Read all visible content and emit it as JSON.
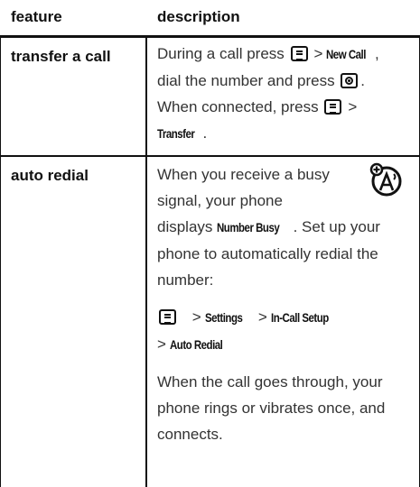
{
  "table": {
    "headers": {
      "feature": "feature",
      "description": "description"
    },
    "rows": [
      {
        "feature": "transfer a call",
        "description": {
          "part1": "During a call press",
          "menu1": "New Call",
          "part2": "dial the number and press",
          "part3": "When connected, press",
          "menu2": "Transfer",
          "gt": ">",
          "comma": ",",
          "period": "."
        }
      },
      {
        "feature": "auto redial",
        "icon": "auto-redial-icon",
        "description": {
          "line1": "When you receive a busy",
          "line2": "signal, your phone",
          "part3": "displays",
          "menu_busy": "Number Busy",
          "part4": ". Set up your phone to automatically redial the number:",
          "path": [
            "Settings",
            "In-Call Setup",
            "Auto Redial"
          ],
          "gt": ">",
          "closing": "When the call goes through, your phone rings or vibrates once, and connects."
        }
      }
    ]
  }
}
